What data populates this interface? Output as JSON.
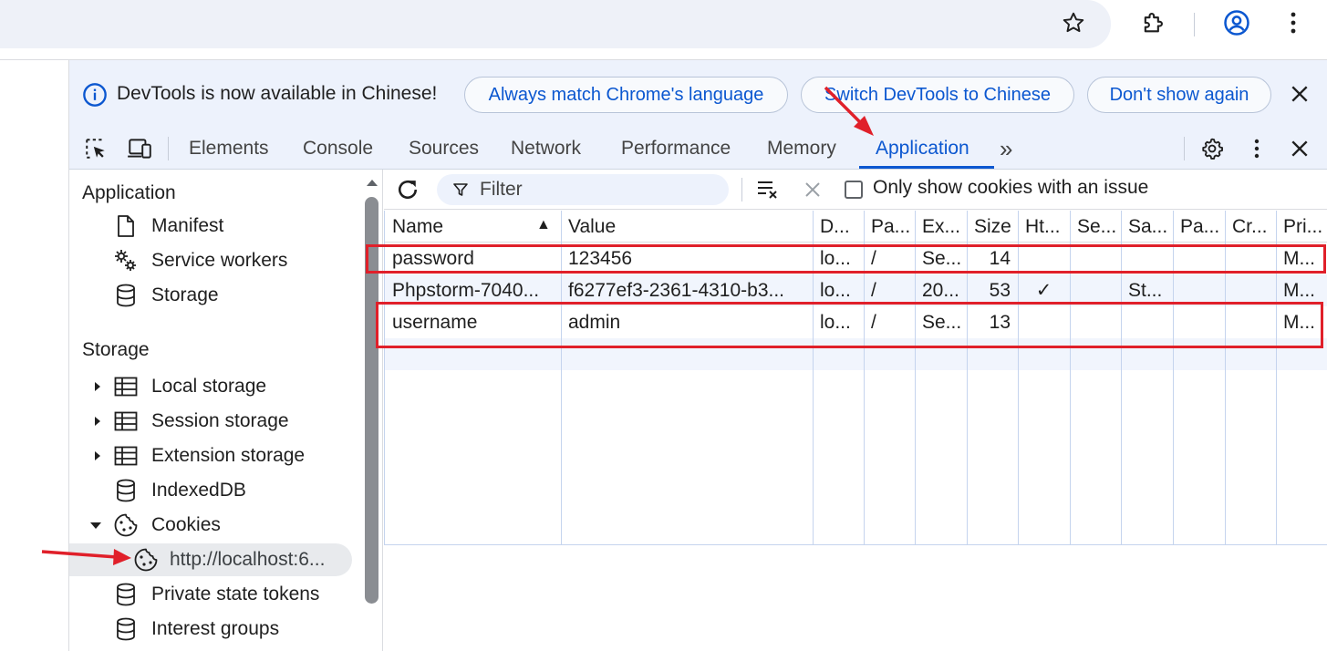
{
  "browser": {
    "icons": [
      "star-icon",
      "extensions-icon",
      "profile-icon",
      "more-vert-icon"
    ]
  },
  "infobar": {
    "message": "DevTools is now available in Chinese!",
    "btn_match": "Always match Chrome's language",
    "btn_switch": "Switch DevTools to Chinese",
    "btn_dont_show": "Don't show again"
  },
  "tabs": {
    "elements": "Elements",
    "console": "Console",
    "sources": "Sources",
    "network": "Network",
    "performance": "Performance",
    "memory": "Memory",
    "application": "Application",
    "more": "»"
  },
  "sidebar": {
    "application_heading": "Application",
    "manifest": "Manifest",
    "service_workers": "Service workers",
    "storage_item": "Storage",
    "storage_heading": "Storage",
    "local_storage": "Local storage",
    "session_storage": "Session storage",
    "extension_storage": "Extension storage",
    "indexeddb": "IndexedDB",
    "cookies": "Cookies",
    "cookie_origin": "http://localhost:6...",
    "private_state_tokens": "Private state tokens",
    "interest_groups": "Interest groups"
  },
  "toolbar": {
    "filter_placeholder": "Filter",
    "only_issue_label": "Only show cookies with an issue"
  },
  "table": {
    "headers": [
      "Name",
      "Value",
      "D...",
      "Pa...",
      "Ex...",
      "Size",
      "Ht...",
      "Se...",
      "Sa...",
      "Pa...",
      "Cr...",
      "Pri..."
    ],
    "sort_indicator": "▲",
    "rows": [
      [
        "password",
        "123456",
        "lo...",
        "/",
        "Se...",
        "14",
        "",
        "",
        "",
        "",
        "",
        "M..."
      ],
      [
        "Phpstorm-7040...",
        "f6277ef3-2361-4310-b3...",
        "lo...",
        "/",
        "20...",
        "53",
        "✓",
        "",
        "St...",
        "",
        "",
        "M..."
      ],
      [
        "username",
        "admin",
        "lo...",
        "/",
        "Se...",
        "13",
        "",
        "",
        "",
        "",
        "",
        "M..."
      ]
    ]
  },
  "colors": {
    "accent": "#0b57d0",
    "annotation_red": "#e0202a"
  }
}
